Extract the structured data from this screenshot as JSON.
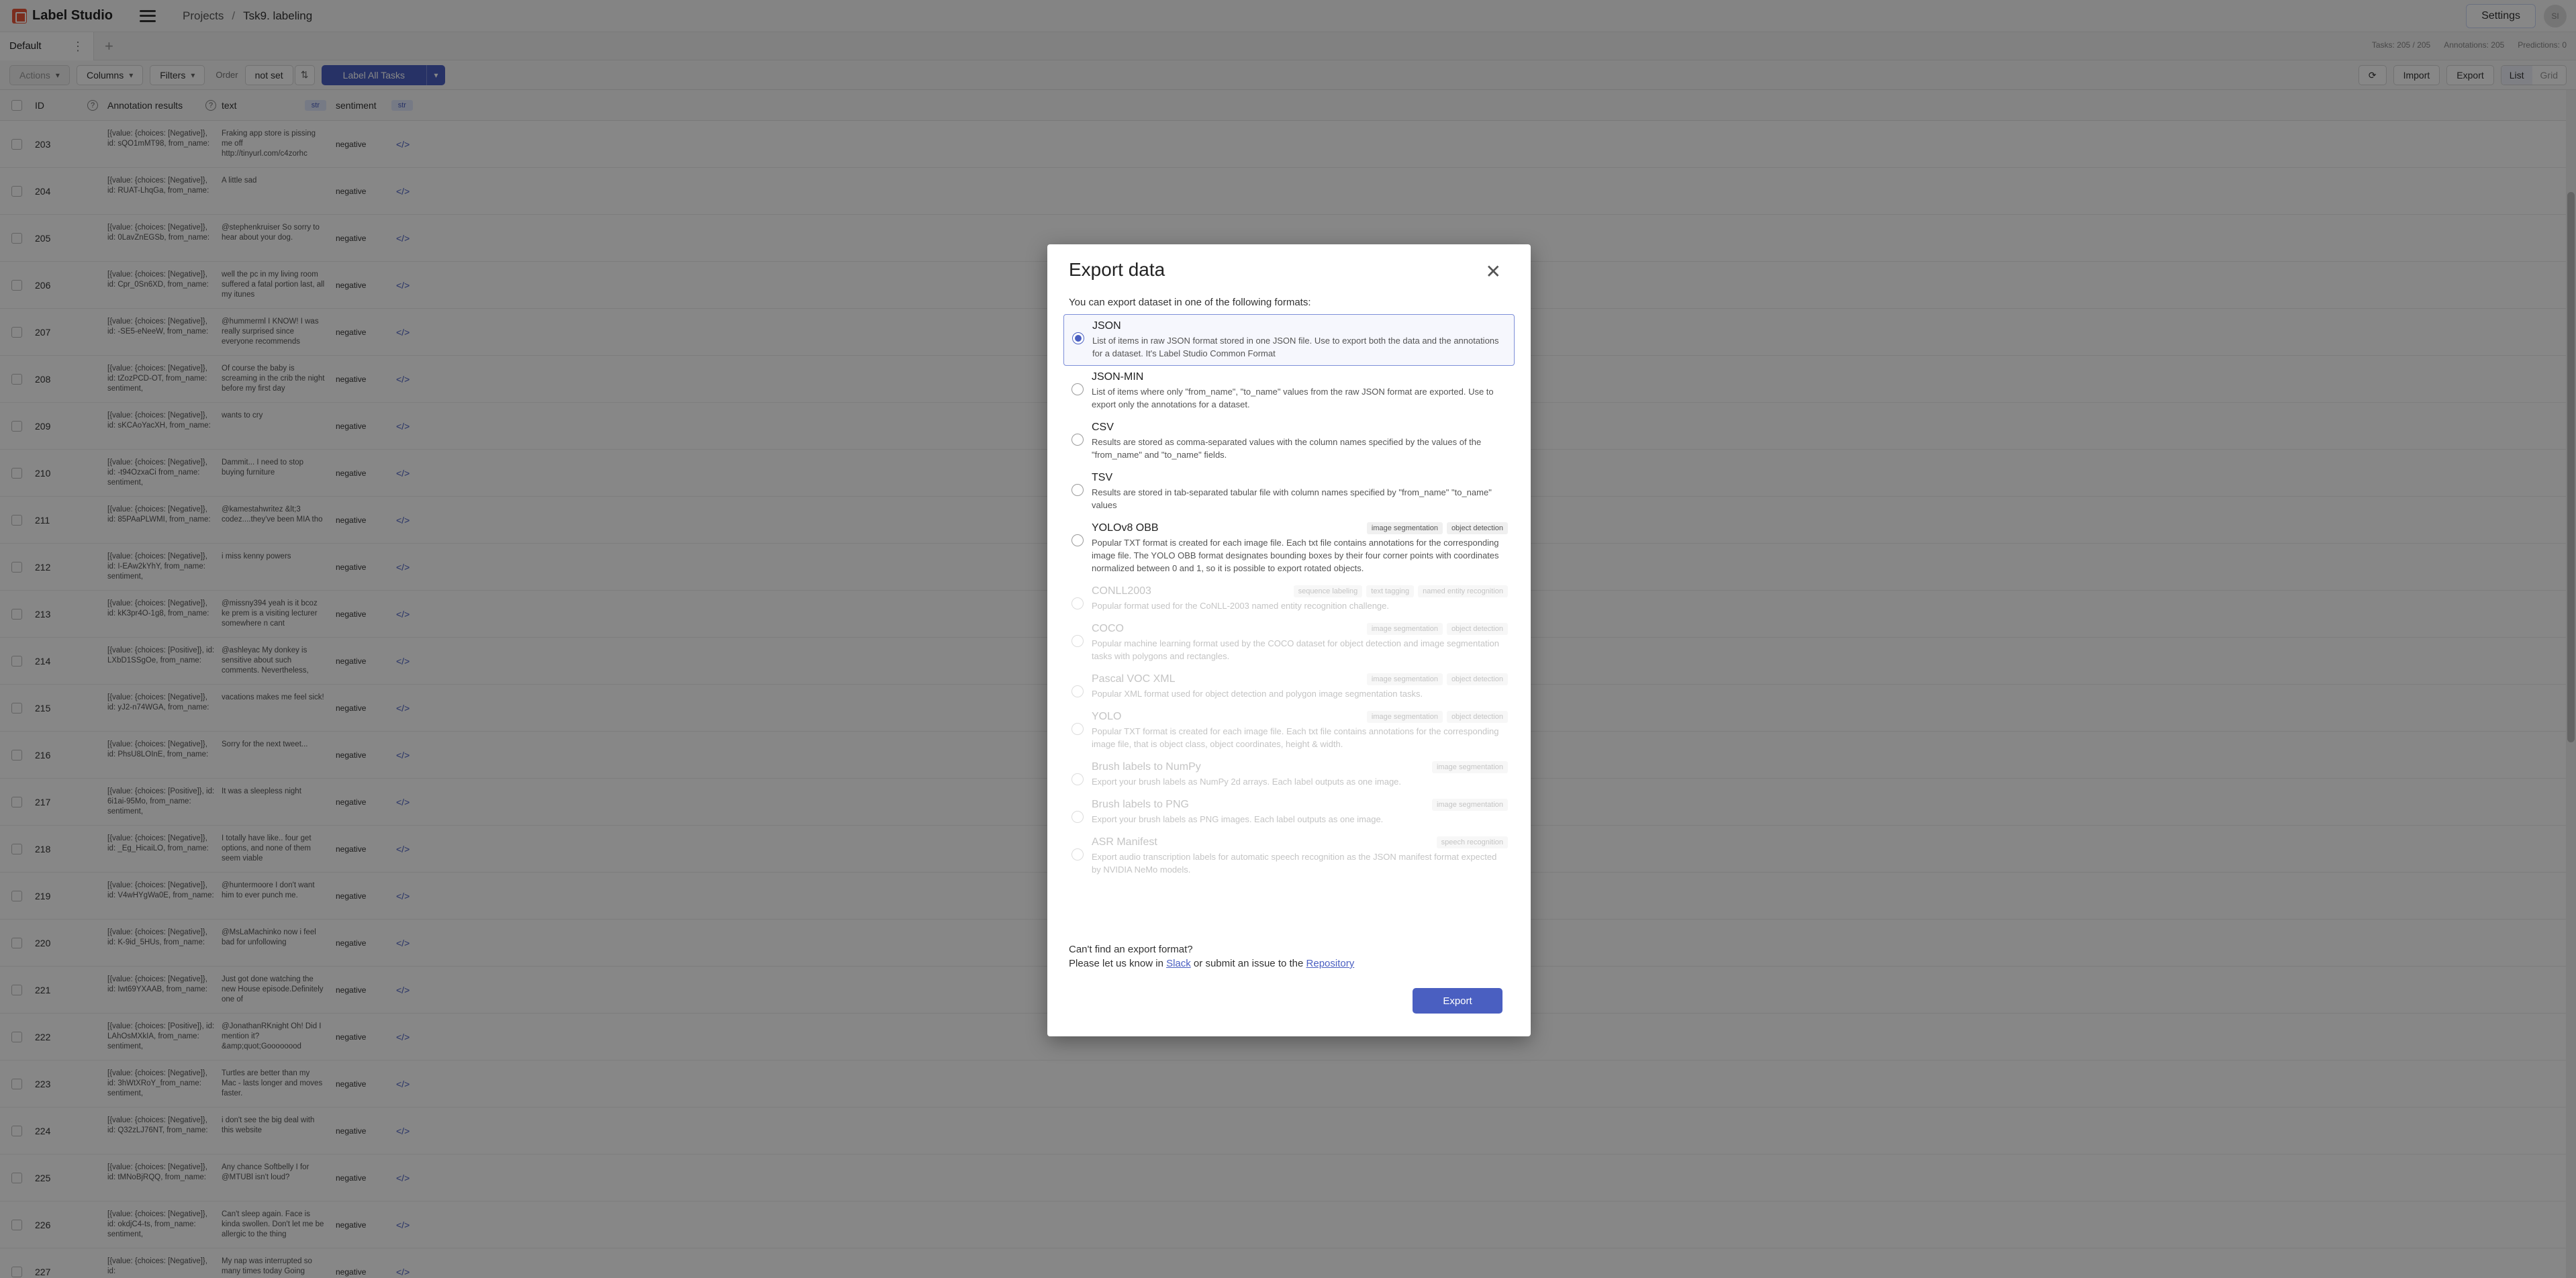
{
  "header": {
    "app_name": "Label Studio",
    "breadcrumb": {
      "projects": "Projects",
      "separator": "/",
      "current": "Tsk9. labeling"
    },
    "settings_label": "Settings",
    "avatar_initials": "SI"
  },
  "tabs": {
    "default_label": "Default",
    "menu_glyph": "⋮",
    "add_glyph": "+"
  },
  "stats": {
    "tasks": "Tasks: 205 / 205",
    "annotations": "Annotations: 205",
    "predictions": "Predictions: 0"
  },
  "toolbar": {
    "actions": "Actions",
    "columns": "Columns",
    "filters": "Filters",
    "order_label": "Order",
    "order_value": "not set",
    "label_all": "Label All Tasks",
    "import": "Import",
    "export": "Export",
    "view_list": "List",
    "view_grid": "Grid"
  },
  "table": {
    "headers": {
      "id": "ID",
      "annotation_results": "Annotation results",
      "text": "text",
      "sentiment": "sentiment",
      "type_badge": "str"
    },
    "rows": [
      {
        "id": "203",
        "ann": "[{value: {choices: [Negative]}, id: sQO1mMT98, from_name:",
        "text": "Fraking app store is pissing me off http://tinyurl.com/c4zorhc",
        "sentiment": "negative"
      },
      {
        "id": "204",
        "ann": "[{value: {choices: [Negative]}, id: RUAT-LhqGa, from_name:",
        "text": "A little sad",
        "sentiment": "negative"
      },
      {
        "id": "205",
        "ann": "[{value: {choices: [Negative]}, id: 0LavZnEGSb, from_name:",
        "text": "@stephenkruiser So sorry to hear about your dog.",
        "sentiment": "negative"
      },
      {
        "id": "206",
        "ann": "[{value: {choices: [Negative]}, id: Cpr_0Sn6XD, from_name:",
        "text": "well the pc in my living room suffered a fatal portion last, all my itunes",
        "sentiment": "negative"
      },
      {
        "id": "207",
        "ann": "[{value: {choices: [Negative]}, id: -SE5-eNeeW, from_name:",
        "text": "@hummerml I KNOW! I was really surprised since everyone recommends",
        "sentiment": "negative"
      },
      {
        "id": "208",
        "ann": "[{value: {choices: [Negative]}, id: tZozPCD-OT, from_name: sentiment,",
        "text": "Of course the baby is screaming in the crib the night before my first day",
        "sentiment": "negative"
      },
      {
        "id": "209",
        "ann": "[{value: {choices: [Negative]}, id: sKCAoYacXH, from_name:",
        "text": "wants to cry",
        "sentiment": "negative"
      },
      {
        "id": "210",
        "ann": "[{value: {choices: [Negative]}, id: -t94OzxaCi from_name: sentiment,",
        "text": "Dammit... I need to stop buying furniture",
        "sentiment": "negative"
      },
      {
        "id": "211",
        "ann": "[{value: {choices: [Negative]}, id: 85PAaPLWMI, from_name:",
        "text": "@kamestahwritez &lt;3 codez....they've been MIA tho",
        "sentiment": "negative"
      },
      {
        "id": "212",
        "ann": "[{value: {choices: [Negative]}, id: I-EAw2kYhY, from_name: sentiment,",
        "text": "i miss kenny powers",
        "sentiment": "negative"
      },
      {
        "id": "213",
        "ann": "[{value: {choices: [Negative]}, id: kK3pr4O-1g8, from_name:",
        "text": "@missny394 yeah is it bcoz ke prem is a visiting lecturer somewhere n cant",
        "sentiment": "negative"
      },
      {
        "id": "214",
        "ann": "[{value: {choices: [Positive]}, id: LXbD1SSgOe, from_name:",
        "text": "@ashleyac My donkey is sensitive about such comments. Nevertheless,",
        "sentiment": "negative"
      },
      {
        "id": "215",
        "ann": "[{value: {choices: [Negative]}, id: yJ2-n74WGA, from_name:",
        "text": "vacations makes me feel sick!",
        "sentiment": "negative"
      },
      {
        "id": "216",
        "ann": "[{value: {choices: [Negative]}, id: PhsU8LOInE, from_name:",
        "text": "Sorry for the next tweet...",
        "sentiment": "negative"
      },
      {
        "id": "217",
        "ann": "[{value: {choices: [Positive]}, id: 6i1ai-95Mo, from_name: sentiment,",
        "text": "It was a sleepless night",
        "sentiment": "negative"
      },
      {
        "id": "218",
        "ann": "[{value: {choices: [Negative]}, id: _Eg_HicaiLO, from_name:",
        "text": "I totally have like.. four get options, and none of them seem viable",
        "sentiment": "negative"
      },
      {
        "id": "219",
        "ann": "[{value: {choices: [Negative]}, id: V4wHYgWa0E, from_name:",
        "text": "@huntermoore I don't want him to ever punch me.",
        "sentiment": "negative"
      },
      {
        "id": "220",
        "ann": "[{value: {choices: [Negative]}, id: K-9id_5HUs, from_name:",
        "text": "@MsLaMachinko now i feel bad for unfollowing",
        "sentiment": "negative"
      },
      {
        "id": "221",
        "ann": "[{value: {choices: [Negative]}, id: Iwt69YXAAB, from_name:",
        "text": "Just got done watching the new House episode.Definitely one of",
        "sentiment": "negative"
      },
      {
        "id": "222",
        "ann": "[{value: {choices: [Positive]}, id: LAhOsMXkIA, from_name: sentiment,",
        "text": "@JonathanRKnight Oh! Did I mention it? &amp;quot;Goooooood",
        "sentiment": "negative"
      },
      {
        "id": "223",
        "ann": "[{value: {choices: [Negative]}, id: 3hWtXRoY_from_name: sentiment,",
        "text": "Turtles are better than my Mac - lasts longer and moves faster.",
        "sentiment": "negative"
      },
      {
        "id": "224",
        "ann": "[{value: {choices: [Negative]}, id: Q32zLJ76NT, from_name:",
        "text": "i don't see the big deal with this website",
        "sentiment": "negative"
      },
      {
        "id": "225",
        "ann": "[{value: {choices: [Negative]}, id: tMNoBjRQQ, from_name:",
        "text": "Any chance Softbelly I for @MTUBl isn't loud?",
        "sentiment": "negative"
      },
      {
        "id": "226",
        "ann": "[{value: {choices: [Negative]}, id: okdjC4-ts, from_name: sentiment,",
        "text": "Can't sleep again. Face is kinda swollen. Don't let me be allergic to the thing",
        "sentiment": "negative"
      },
      {
        "id": "227",
        "ann": "[{value: {choices: [Negative]}, id:",
        "text": "My nap was interrupted so many times today Going",
        "sentiment": "negative"
      }
    ],
    "code_glyph": "</>"
  },
  "modal": {
    "title": "Export data",
    "close_glyph": "✕",
    "description": "You can export dataset in one of the following formats:",
    "formats": [
      {
        "title": "JSON",
        "text": "List of items in raw JSON format stored in one JSON file. Use to export both the data and the annotations for a dataset. It's Label Studio Common Format",
        "tags": [],
        "selected": true,
        "disabled": false
      },
      {
        "title": "JSON-MIN",
        "text": "List of items where only \"from_name\", \"to_name\" values from the raw JSON format are exported. Use to export only the annotations for a dataset.",
        "tags": [],
        "selected": false,
        "disabled": false
      },
      {
        "title": "CSV",
        "text": "Results are stored as comma-separated values with the column names specified by the values of the \"from_name\" and \"to_name\" fields.",
        "tags": [],
        "selected": false,
        "disabled": false
      },
      {
        "title": "TSV",
        "text": "Results are stored in tab-separated tabular file with column names specified by \"from_name\" \"to_name\" values",
        "tags": [],
        "selected": false,
        "disabled": false
      },
      {
        "title": "YOLOv8 OBB",
        "text": "Popular TXT format is created for each image file. Each txt file contains annotations for the corresponding image file. The YOLO OBB format designates bounding boxes by their four corner points with coordinates normalized between 0 and 1, so it is possible to export rotated objects.",
        "tags": [
          "image segmentation",
          "object detection"
        ],
        "selected": false,
        "disabled": false
      },
      {
        "title": "CONLL2003",
        "text": "Popular format used for the CoNLL-2003 named entity recognition challenge.",
        "tags": [
          "sequence labeling",
          "text tagging",
          "named entity recognition"
        ],
        "selected": false,
        "disabled": true
      },
      {
        "title": "COCO",
        "text": "Popular machine learning format used by the COCO dataset for object detection and image segmentation tasks with polygons and rectangles.",
        "tags": [
          "image segmentation",
          "object detection"
        ],
        "selected": false,
        "disabled": true
      },
      {
        "title": "Pascal VOC XML",
        "text": "Popular XML format used for object detection and polygon image segmentation tasks.",
        "tags": [
          "image segmentation",
          "object detection"
        ],
        "selected": false,
        "disabled": true
      },
      {
        "title": "YOLO",
        "text": "Popular TXT format is created for each image file. Each txt file contains annotations for the corresponding image file, that is object class, object coordinates, height & width.",
        "tags": [
          "image segmentation",
          "object detection"
        ],
        "selected": false,
        "disabled": true
      },
      {
        "title": "Brush labels to NumPy",
        "text": "Export your brush labels as NumPy 2d arrays. Each label outputs as one image.",
        "tags": [
          "image segmentation"
        ],
        "selected": false,
        "disabled": true
      },
      {
        "title": "Brush labels to PNG",
        "text": "Export your brush labels as PNG images. Each label outputs as one image.",
        "tags": [
          "image segmentation"
        ],
        "selected": false,
        "disabled": true
      },
      {
        "title": "ASR Manifest",
        "text": "Export audio transcription labels for automatic speech recognition as the JSON manifest format expected by NVIDIA NeMo models.",
        "tags": [
          "speech recognition"
        ],
        "selected": false,
        "disabled": true
      }
    ],
    "footer_line1": "Can't find an export format?",
    "footer_prefix": "Please let us know in ",
    "footer_slack": "Slack",
    "footer_middle": " or submit an issue to the ",
    "footer_repo": "Repository",
    "export_button": "Export"
  }
}
